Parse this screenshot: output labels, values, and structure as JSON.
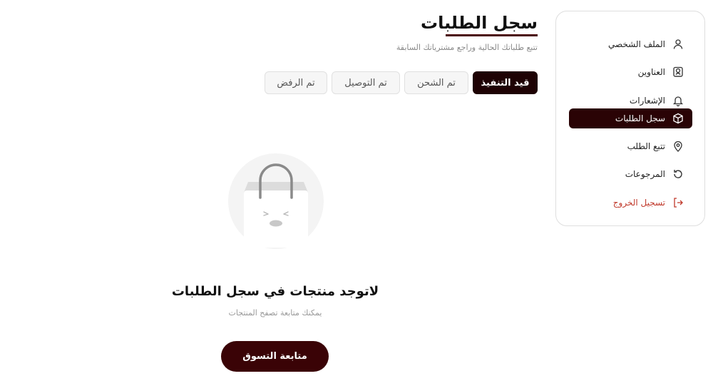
{
  "sidebar": {
    "items": [
      {
        "label": "الملف الشخصي",
        "icon": "user-icon"
      },
      {
        "label": "العناوين",
        "icon": "address-icon"
      },
      {
        "label": "الإشعارات",
        "icon": "bell-icon"
      },
      {
        "label": "سجل الطلبات",
        "icon": "box-icon"
      },
      {
        "label": "تتبع الطلب",
        "icon": "location-pin-icon"
      },
      {
        "label": "المرجوعات",
        "icon": "return-icon"
      },
      {
        "label": "تسجيل الخروج",
        "icon": "logout-icon"
      }
    ],
    "active_index": 3
  },
  "header": {
    "title": "سجل الطلبات",
    "subtitle": "تتبع طلباتك الحالية وراجع مشترياتك السابقة"
  },
  "tabs": [
    {
      "label": "قيد التنفيذ"
    },
    {
      "label": "تم الشحن"
    },
    {
      "label": "تم التوصيل"
    },
    {
      "label": "تم الرفض"
    }
  ],
  "active_tab": 0,
  "empty_state": {
    "title": "لاتوجد منتجات في سجل الطلبات",
    "subtitle": "يمكنك متابعة تصفح المنتجات",
    "button": "متابعة التسوق"
  },
  "colors": {
    "accent": "#2a0305",
    "button": "#3a0306",
    "logout": "#c0392b"
  }
}
